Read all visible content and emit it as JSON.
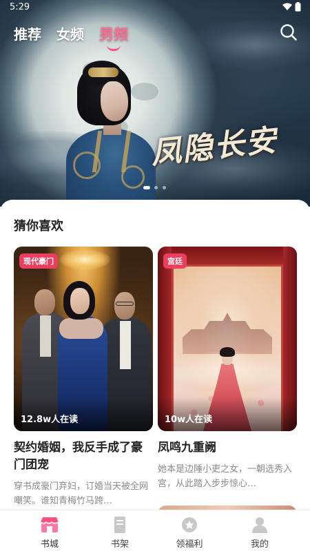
{
  "status_bar": {
    "time": "5:29"
  },
  "top_nav": {
    "tabs": [
      {
        "label": "推荐",
        "active": false
      },
      {
        "label": "女频",
        "active": false
      },
      {
        "label": "男频",
        "active": true
      }
    ],
    "search_icon": "search-icon"
  },
  "banner": {
    "title": "凤隐长安",
    "carousel": {
      "count": 3,
      "active_index": 0
    }
  },
  "recommend": {
    "section_title": "猜你喜欢",
    "books": [
      {
        "tag": "现代豪门",
        "readers": "12.8w人在读",
        "title": "契约婚姻，我反手成了豪门团宠",
        "description": "穿书成豪门弃妇，订婚当天被全网嘲笑。谁知青梅竹马跨…"
      },
      {
        "tag": "宫廷",
        "readers": "10w人在读",
        "title": "凤鸣九重阙",
        "description": "她本是边陲小吏之女，一朝选秀入宫，从此踏入步步惊心…"
      }
    ]
  },
  "bottom_nav": {
    "items": [
      {
        "label": "书城",
        "icon": "store-icon",
        "active": true
      },
      {
        "label": "书架",
        "icon": "bookshelf-icon",
        "active": false
      },
      {
        "label": "领福利",
        "icon": "gift-icon",
        "active": false
      },
      {
        "label": "我的",
        "icon": "profile-icon",
        "active": false
      }
    ]
  },
  "colors": {
    "accent": "#ff4f7f",
    "tag_bg": "#ea3f5e",
    "text_primary": "#222222",
    "text_secondary": "#8a8a8a"
  }
}
